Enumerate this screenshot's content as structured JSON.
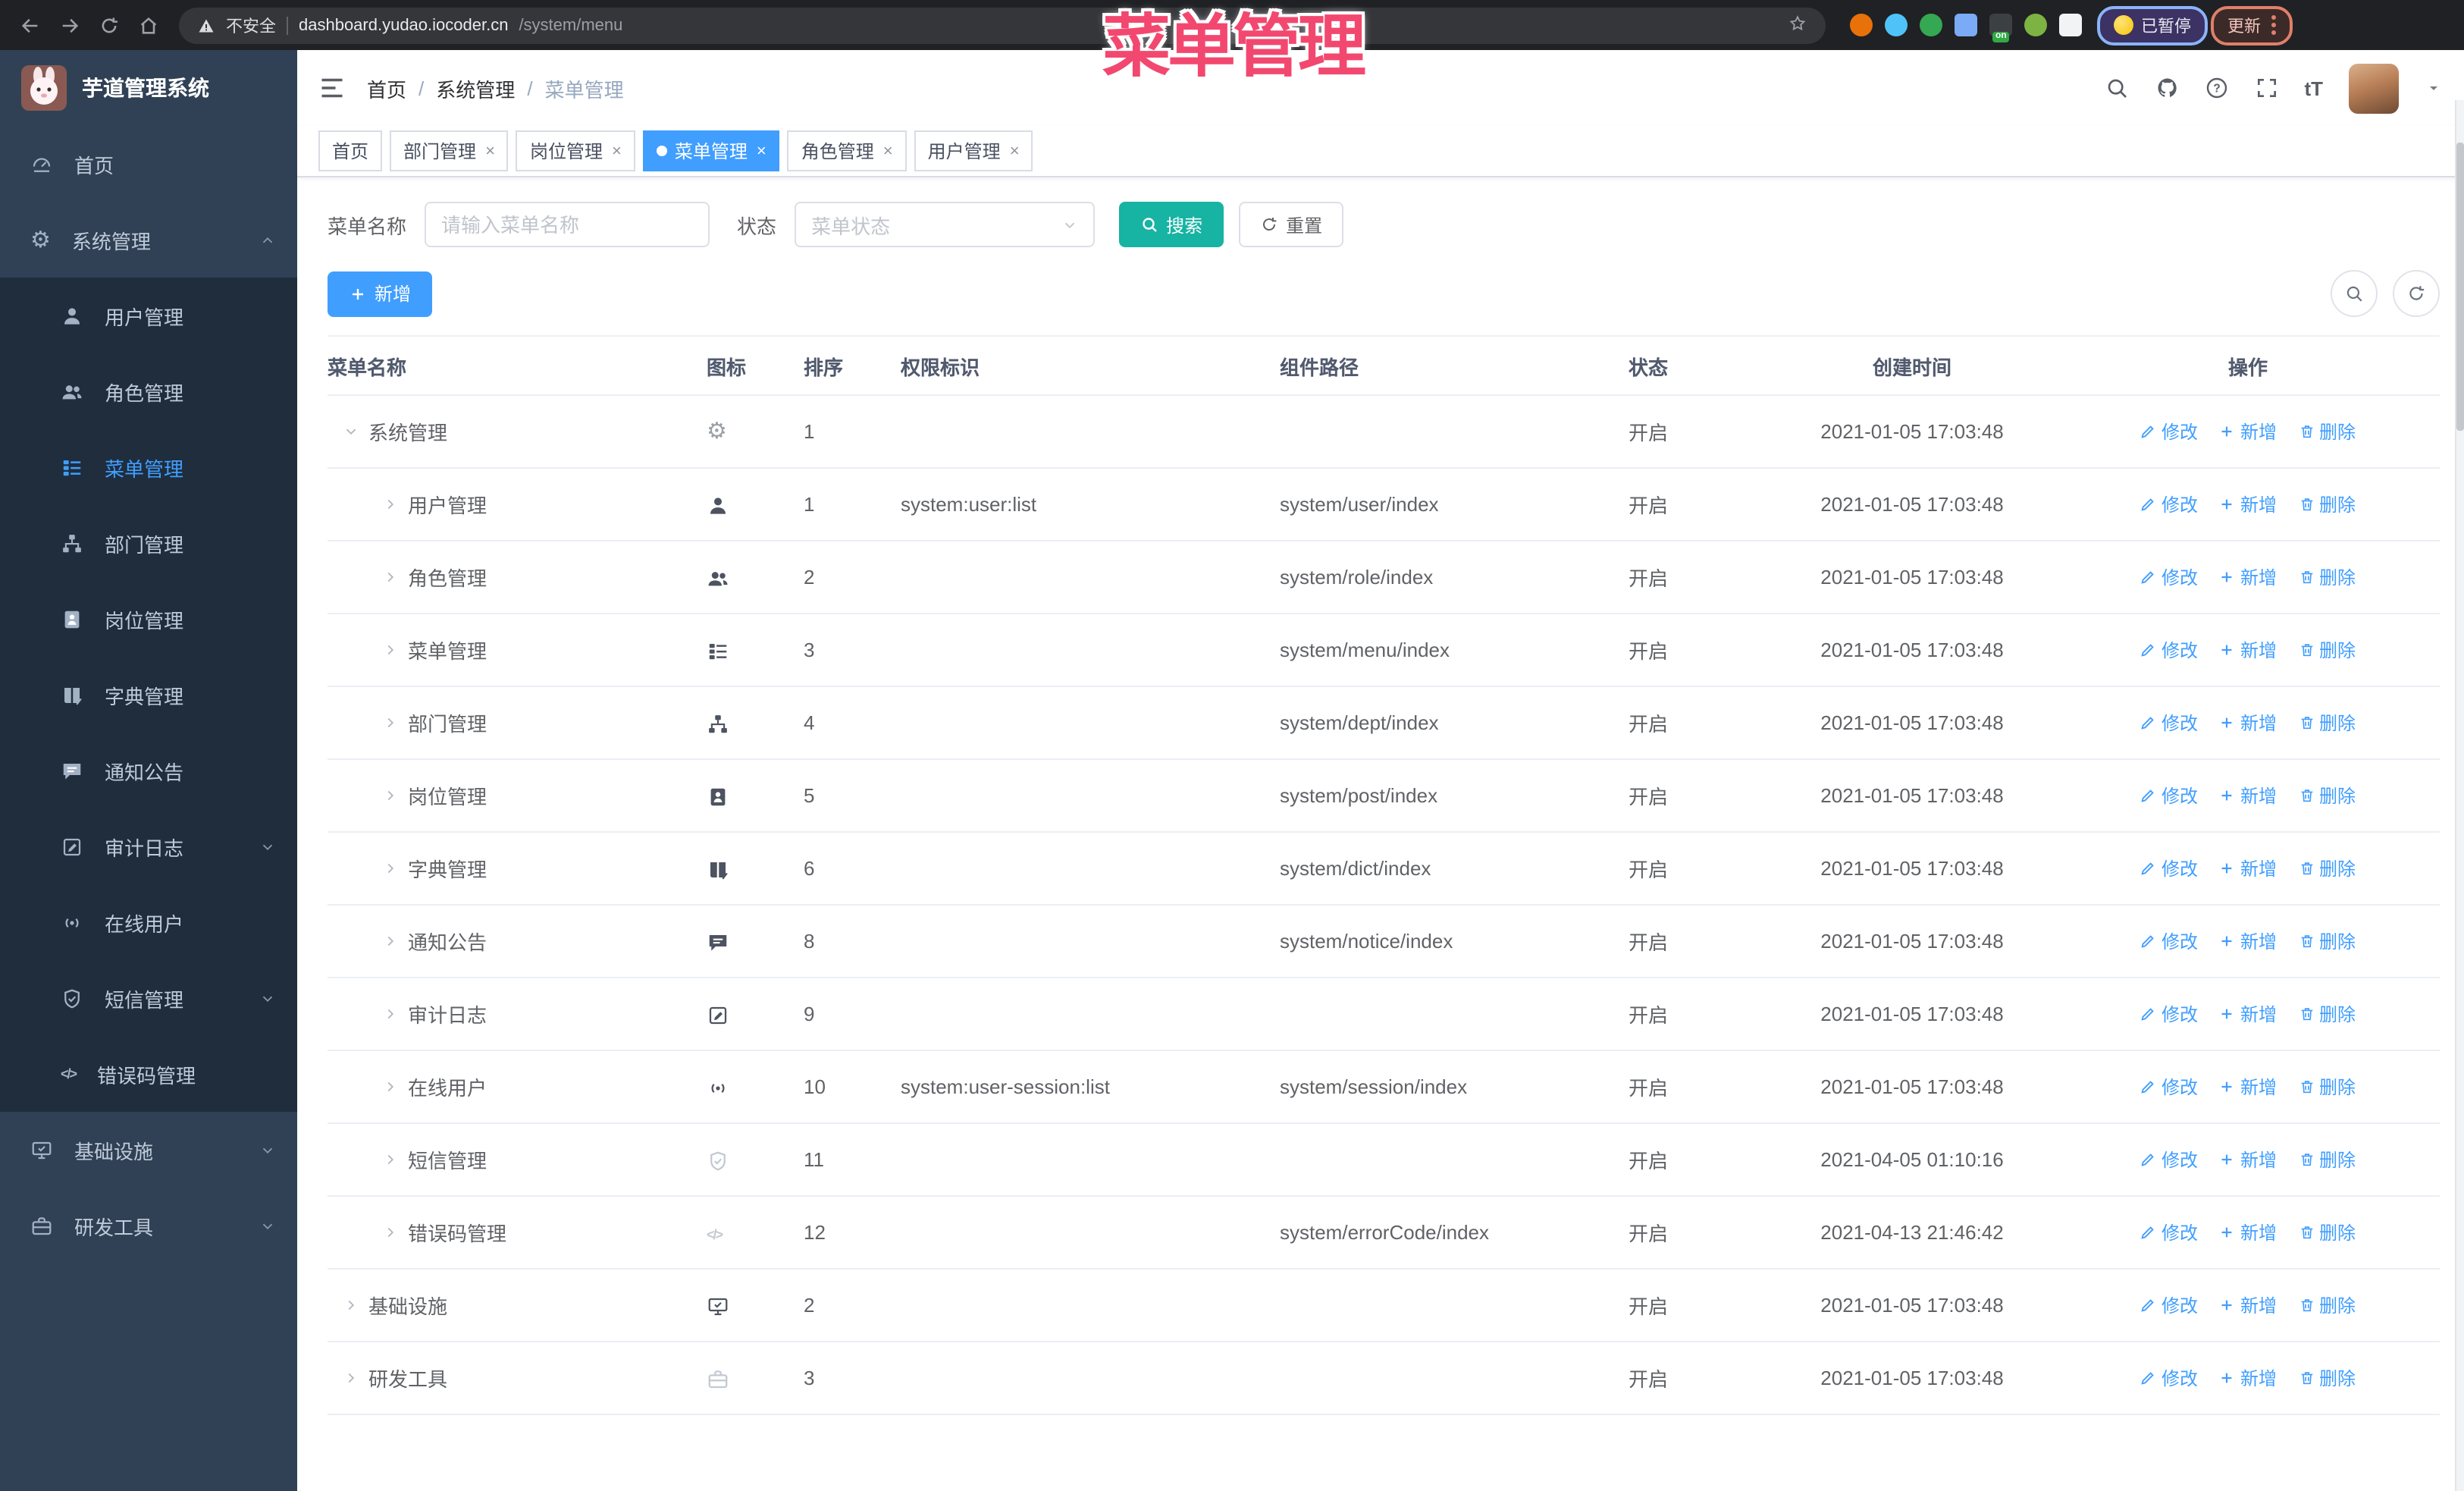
{
  "colors": {
    "accent": "#409EFF",
    "teal": "#17B3A3",
    "sidebar_bg": "#304156",
    "submenu_bg": "#1F2D3D",
    "tag_active": "#409EFF",
    "overlay": "#F2486F",
    "link": "#409EFF"
  },
  "overlay_title": "菜单管理",
  "browser": {
    "security_label": "不安全",
    "url_host": "dashboard.yudao.iocoder.cn",
    "url_path": "/system/menu",
    "paused_chip": "已暂停",
    "update_label": "更新",
    "extension_badge": "on",
    "extension_colors": [
      "#e8710a",
      "#4fc3f7",
      "#34a853",
      "#7baaf7",
      "#3c4043",
      "#7cb342",
      "#f1f3f4"
    ]
  },
  "sidebar": {
    "logo_title": "芋道管理系统",
    "items": [
      {
        "key": "home",
        "label": "首页",
        "icon": "dashboard",
        "level": 0
      },
      {
        "key": "system",
        "label": "系统管理",
        "icon": "gear",
        "level": 0,
        "chevron": "up"
      },
      {
        "key": "user",
        "label": "用户管理",
        "icon": "user",
        "level": 1
      },
      {
        "key": "role",
        "label": "角色管理",
        "icon": "users",
        "level": 1
      },
      {
        "key": "menu",
        "label": "菜单管理",
        "icon": "menu",
        "level": 1,
        "active": true
      },
      {
        "key": "dept",
        "label": "部门管理",
        "icon": "org",
        "level": 1
      },
      {
        "key": "post",
        "label": "岗位管理",
        "icon": "badge",
        "level": 1
      },
      {
        "key": "dict",
        "label": "字典管理",
        "icon": "dict",
        "level": 1
      },
      {
        "key": "notice",
        "label": "通知公告",
        "icon": "notice",
        "level": 1
      },
      {
        "key": "auditlog",
        "label": "审计日志",
        "icon": "log",
        "level": 1,
        "chevron": "down"
      },
      {
        "key": "online",
        "label": "在线用户",
        "icon": "online",
        "level": 1
      },
      {
        "key": "sms",
        "label": "短信管理",
        "icon": "shield",
        "level": 1,
        "chevron": "down"
      },
      {
        "key": "errorcode",
        "label": "错误码管理",
        "icon": "code",
        "level": 1
      },
      {
        "key": "infra",
        "label": "基础设施",
        "icon": "monitor",
        "level": 0,
        "chevron": "down"
      },
      {
        "key": "devtool",
        "label": "研发工具",
        "icon": "toolbox",
        "level": 0,
        "chevron": "down"
      }
    ]
  },
  "header": {
    "breadcrumb": {
      "items": [
        "首页",
        "系统管理",
        "菜单管理"
      ],
      "separator": "/"
    },
    "right_icons": [
      "search",
      "github",
      "help",
      "fullscreen",
      "fontsize"
    ]
  },
  "tabs": [
    {
      "key": "home",
      "label": "首页",
      "closable": false,
      "active": false
    },
    {
      "key": "dept",
      "label": "部门管理",
      "closable": true,
      "active": false
    },
    {
      "key": "post",
      "label": "岗位管理",
      "closable": true,
      "active": false
    },
    {
      "key": "menu",
      "label": "菜单管理",
      "closable": true,
      "active": true
    },
    {
      "key": "role",
      "label": "角色管理",
      "closable": true,
      "active": false
    },
    {
      "key": "user",
      "label": "用户管理",
      "closable": true,
      "active": false
    }
  ],
  "search": {
    "name_label": "菜单名称",
    "name_placeholder": "请输入菜单名称",
    "status_label": "状态",
    "status_placeholder": "菜单状态",
    "search_label": "搜索",
    "reset_label": "重置"
  },
  "toolbar": {
    "add_label": "新增"
  },
  "table": {
    "headers": [
      "菜单名称",
      "图标",
      "排序",
      "权限标识",
      "组件路径",
      "状态",
      "创建时间",
      "操作"
    ],
    "row_actions": [
      {
        "key": "edit",
        "label": "修改",
        "icon": "edit"
      },
      {
        "key": "add",
        "label": "新增",
        "icon": "plus"
      },
      {
        "key": "delete",
        "label": "删除",
        "icon": "trash"
      }
    ],
    "rows": [
      {
        "key": "system",
        "name": "系统管理",
        "level": 0,
        "expand": "down",
        "icon": "gear",
        "tone": "mid",
        "sort": "1",
        "perm": "",
        "path": "",
        "status": "开启",
        "time": "2021-01-05 17:03:48"
      },
      {
        "key": "user",
        "name": "用户管理",
        "level": 1,
        "expand": "right",
        "icon": "user",
        "tone": "dark",
        "sort": "1",
        "perm": "system:user:list",
        "path": "system/user/index",
        "status": "开启",
        "time": "2021-01-05 17:03:48"
      },
      {
        "key": "role",
        "name": "角色管理",
        "level": 1,
        "expand": "right",
        "icon": "users",
        "tone": "dark",
        "sort": "2",
        "perm": "",
        "path": "system/role/index",
        "status": "开启",
        "time": "2021-01-05 17:03:48"
      },
      {
        "key": "menu",
        "name": "菜单管理",
        "level": 1,
        "expand": "right",
        "icon": "menu",
        "tone": "dark",
        "sort": "3",
        "perm": "",
        "path": "system/menu/index",
        "status": "开启",
        "time": "2021-01-05 17:03:48"
      },
      {
        "key": "dept",
        "name": "部门管理",
        "level": 1,
        "expand": "right",
        "icon": "org",
        "tone": "dark",
        "sort": "4",
        "perm": "",
        "path": "system/dept/index",
        "status": "开启",
        "time": "2021-01-05 17:03:48"
      },
      {
        "key": "post",
        "name": "岗位管理",
        "level": 1,
        "expand": "right",
        "icon": "badge",
        "tone": "dark",
        "sort": "5",
        "perm": "",
        "path": "system/post/index",
        "status": "开启",
        "time": "2021-01-05 17:03:48"
      },
      {
        "key": "dict",
        "name": "字典管理",
        "level": 1,
        "expand": "right",
        "icon": "dict",
        "tone": "dark",
        "sort": "6",
        "perm": "",
        "path": "system/dict/index",
        "status": "开启",
        "time": "2021-01-05 17:03:48"
      },
      {
        "key": "notice",
        "name": "通知公告",
        "level": 1,
        "expand": "right",
        "icon": "notice",
        "tone": "dark",
        "sort": "8",
        "perm": "",
        "path": "system/notice/index",
        "status": "开启",
        "time": "2021-01-05 17:03:48"
      },
      {
        "key": "auditlog",
        "name": "审计日志",
        "level": 1,
        "expand": "right",
        "icon": "log",
        "tone": "dark",
        "sort": "9",
        "perm": "",
        "path": "",
        "status": "开启",
        "time": "2021-01-05 17:03:48"
      },
      {
        "key": "online",
        "name": "在线用户",
        "level": 1,
        "expand": "right",
        "icon": "online",
        "tone": "dark",
        "sort": "10",
        "perm": "system:user-session:list",
        "path": "system/session/index",
        "status": "开启",
        "time": "2021-01-05 17:03:48"
      },
      {
        "key": "sms",
        "name": "短信管理",
        "level": 1,
        "expand": "right",
        "icon": "shield",
        "tone": "light",
        "sort": "11",
        "perm": "",
        "path": "",
        "status": "开启",
        "time": "2021-04-05 01:10:16"
      },
      {
        "key": "errorcode",
        "name": "错误码管理",
        "level": 1,
        "expand": "right",
        "icon": "code",
        "tone": "light",
        "sort": "12",
        "perm": "",
        "path": "system/errorCode/index",
        "status": "开启",
        "time": "2021-04-13 21:46:42"
      },
      {
        "key": "infra",
        "name": "基础设施",
        "level": 0,
        "expand": "right",
        "icon": "monitor",
        "tone": "dark",
        "sort": "2",
        "perm": "",
        "path": "",
        "status": "开启",
        "time": "2021-01-05 17:03:48"
      },
      {
        "key": "devtool",
        "name": "研发工具",
        "level": 0,
        "expand": "right",
        "icon": "toolbox",
        "tone": "light",
        "sort": "3",
        "perm": "",
        "path": "",
        "status": "开启",
        "time": "2021-01-05 17:03:48"
      }
    ]
  }
}
